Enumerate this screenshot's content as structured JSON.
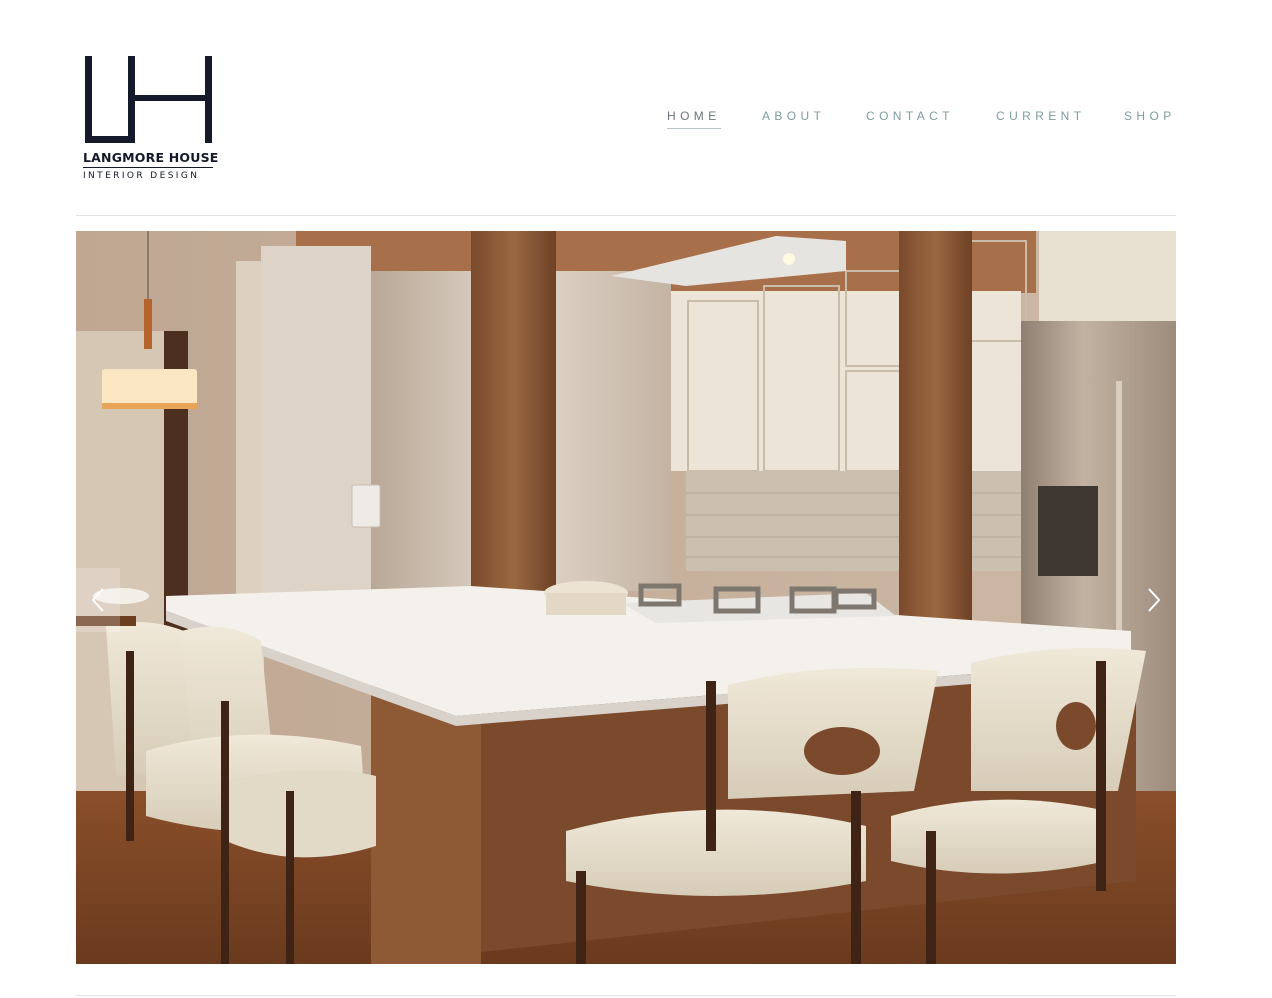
{
  "brand": {
    "monogram": "LH",
    "name": "LANGMORE HOUSE",
    "tagline": "INTERIOR DESIGN"
  },
  "nav": {
    "items": [
      {
        "label": "HOME",
        "active": true
      },
      {
        "label": "ABOUT",
        "active": false
      },
      {
        "label": "CONTACT",
        "active": false
      },
      {
        "label": "CURRENT",
        "active": false
      },
      {
        "label": "SHOP",
        "active": false
      }
    ]
  },
  "slider": {
    "image_subject": "kitchen-island-with-bar-stools",
    "prev_icon": "chevron-left-icon",
    "next_icon": "chevron-right-icon"
  },
  "colors": {
    "brand_navy": "#151a2a",
    "nav_text": "#7d9c9e",
    "nav_active": "#6a7678",
    "divider": "#e2e2e2"
  }
}
